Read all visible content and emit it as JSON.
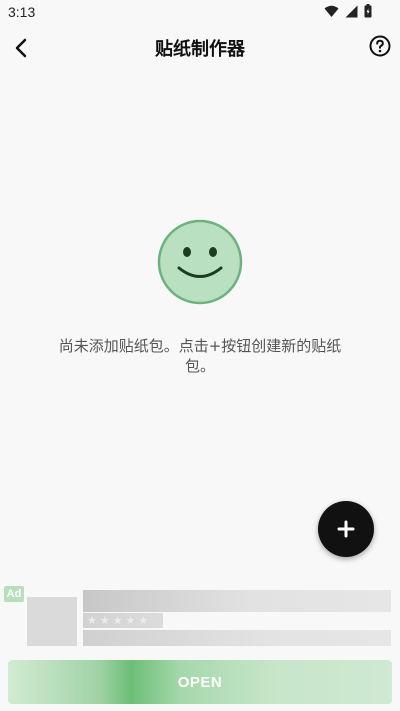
{
  "status_bar": {
    "time": "3:13",
    "icons": [
      "wifi-icon",
      "signal-icon",
      "battery-icon"
    ]
  },
  "app_bar": {
    "title": "贴纸制作器",
    "back_icon": "back-arrow-icon",
    "help_icon": "help-circle-icon"
  },
  "empty_state": {
    "icon": "smiley-icon",
    "message": "尚未添加贴纸包。点击+按钮创建新的贴纸包。"
  },
  "fab": {
    "icon": "plus-icon"
  },
  "ad": {
    "badge": "Ad",
    "button_label": "OPEN"
  },
  "colors": {
    "background": "#f8f8f8",
    "smiley_fill": "#b9e0c0",
    "smiley_stroke": "#6fb07f",
    "fab": "#111111",
    "ad_green": "#6cbe77"
  }
}
